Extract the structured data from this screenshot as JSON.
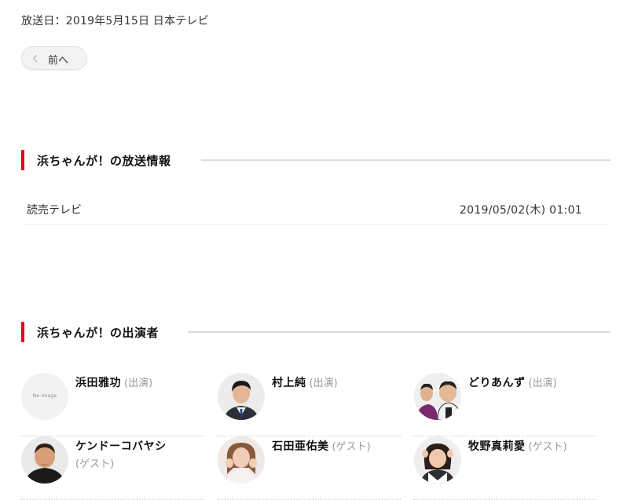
{
  "airdate": "放送日：2019年5月15日 日本テレビ",
  "nav": {
    "prev_label": "前へ"
  },
  "broadcast_section": {
    "title": "浜ちゃんが！の放送情報",
    "rows": [
      {
        "station": "読売テレビ",
        "datetime": "2019/05/02(木) 01:01"
      }
    ]
  },
  "cast_section": {
    "title": "浜ちゃんが！の出演者",
    "cast": [
      {
        "name": "浜田雅功",
        "role": "(出演)",
        "avatar": "no-image",
        "no_image_text": "No Image"
      },
      {
        "name": "村上純",
        "role": "(出演)",
        "avatar": "person-photo"
      },
      {
        "name": "どりあんず",
        "role": "(出演)",
        "avatar": "duo-photo"
      },
      {
        "name": "ケンドーコバヤシ",
        "role": "(ゲスト)",
        "avatar": "person-photo"
      },
      {
        "name": "石田亜佑美",
        "role": "(ゲスト)",
        "avatar": "person-photo"
      },
      {
        "name": "牧野真莉愛",
        "role": "(ゲスト)",
        "avatar": "person-photo"
      }
    ]
  },
  "colors": {
    "accent": "#e60012",
    "role_text": "#999999",
    "rule": "#dcdcdc"
  }
}
